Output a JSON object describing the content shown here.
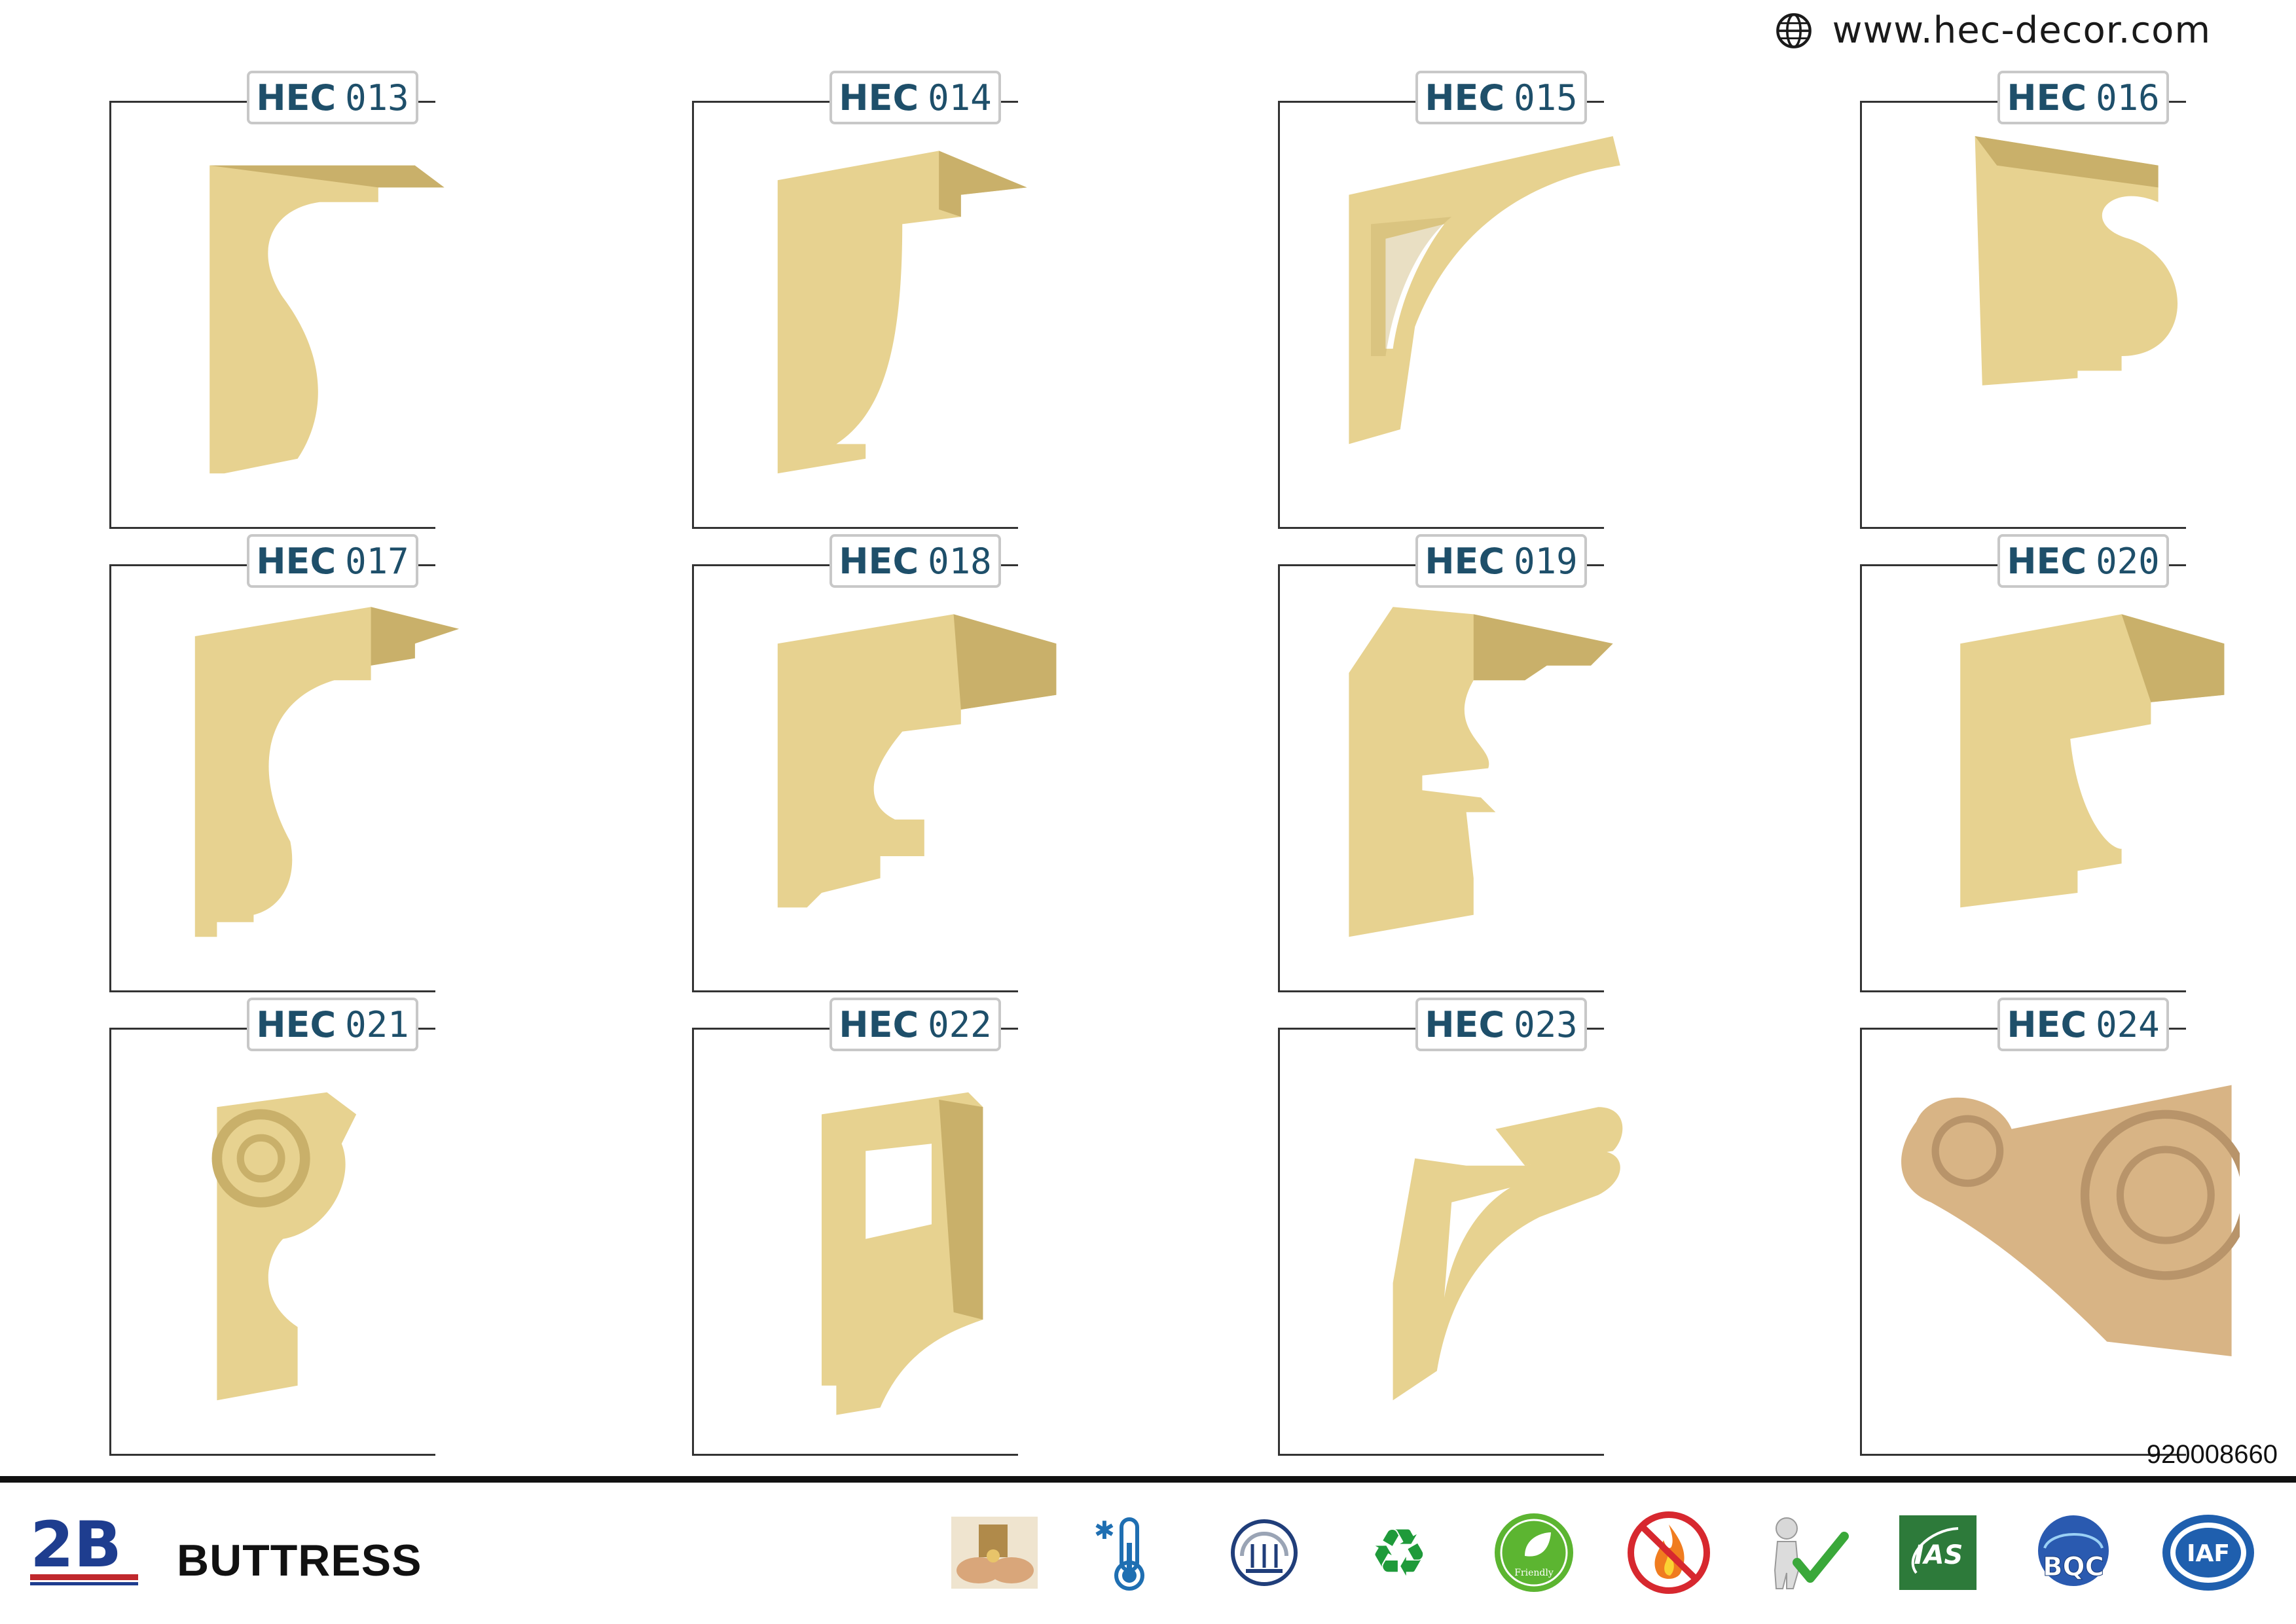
{
  "header": {
    "website": "www.hec-decor.com"
  },
  "products": [
    {
      "prefix": "HEC",
      "number": "013"
    },
    {
      "prefix": "HEC",
      "number": "014"
    },
    {
      "prefix": "HEC",
      "number": "015"
    },
    {
      "prefix": "HEC",
      "number": "016"
    },
    {
      "prefix": "HEC",
      "number": "017"
    },
    {
      "prefix": "HEC",
      "number": "018"
    },
    {
      "prefix": "HEC",
      "number": "019"
    },
    {
      "prefix": "HEC",
      "number": "020"
    },
    {
      "prefix": "HEC",
      "number": "021"
    },
    {
      "prefix": "HEC",
      "number": "022"
    },
    {
      "prefix": "HEC",
      "number": "023"
    },
    {
      "prefix": "HEC",
      "number": "024"
    }
  ],
  "catalog_code": "920008660",
  "footer": {
    "brand": "2B",
    "title": "BUTTRESS",
    "icons": [
      "hands-money-icon",
      "thermometer-icon",
      "moisture-icon",
      "recycle-icon",
      "eco-friendly-icon",
      "fire-resistant-icon",
      "approved-icon",
      "ias-logo",
      "boc-logo",
      "iaf-logo"
    ]
  },
  "colors": {
    "label_text": "#1e4f6a",
    "product_fill": "#e7d290",
    "product_shadow": "#c9b06a",
    "last_product": "#d8b485"
  }
}
